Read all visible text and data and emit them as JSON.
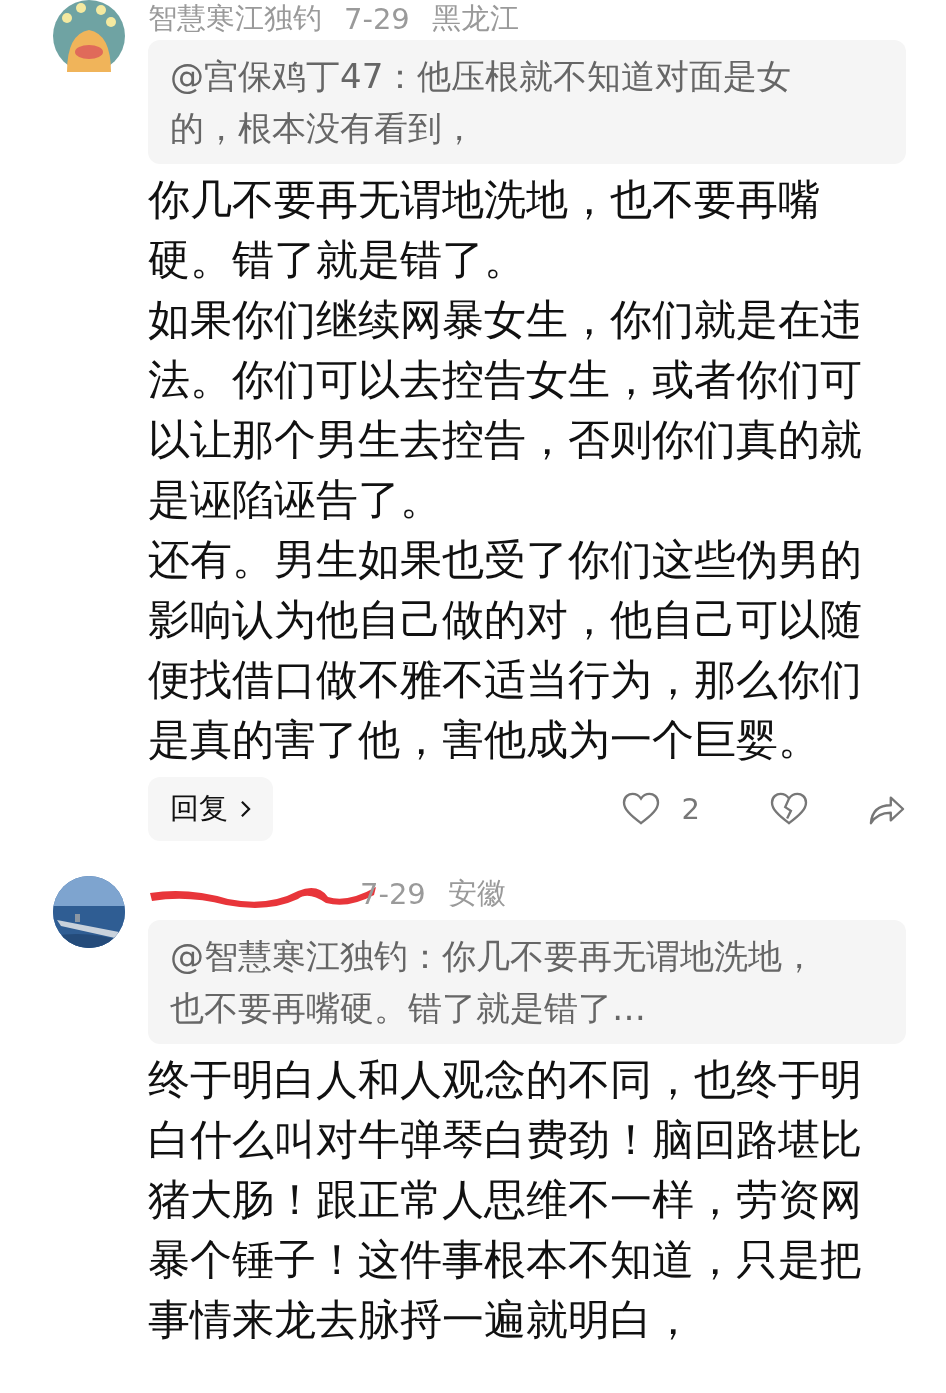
{
  "comments": [
    {
      "avatar": {
        "kind": "picture"
      },
      "username": "智慧寒江独钓",
      "redacted": false,
      "date": "7-29",
      "location": "黑龙江",
      "quote": "@宫保鸡丁47：他压根就不知道对面是女的，根本没有看到，",
      "paragraphs": [
        "你几不要再无谓地洗地，也不要再嘴硬。错了就是错了。",
        "如果你们继续网暴女生，你们就是在违法。你们可以去控告女生，或者你们可以让那个男生去控告，否则你们真的就是诬陷诬告了。",
        "还有。男生如果也受了你们这些伪男的影响认为他自己做的对，他自己可以随便找借口做不雅不适当行为，那么你们是真的害了他，害他成为一个巨婴。"
      ],
      "actions": {
        "reply": "回复",
        "likes": "2"
      }
    },
    {
      "avatar": {
        "kind": "picture"
      },
      "redacted": true,
      "date": "7-29",
      "location": "安徽",
      "quote": "@智慧寒江独钓：你几不要再无谓地洗地，也不要再嘴硬。错了就是错了…",
      "paragraphs": [
        "终于明白人和人观念的不同，也终于明白什么叫对牛弹琴白费劲！脑回路堪比猪大肠！跟正常人思维不一样，劳资网暴个锤子！这件事根本不知道，只是把事情来龙去脉捋一遍就明白，"
      ]
    }
  ]
}
